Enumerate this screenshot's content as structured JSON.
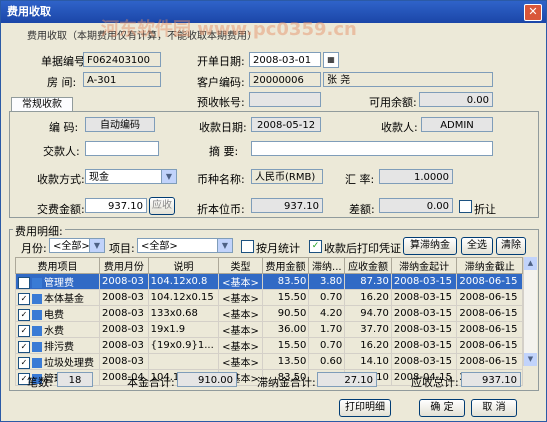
{
  "window": {
    "title": "费用收取",
    "close": "✕"
  },
  "notice": "费用收取（本期费用仅有计算，不能收取本期费用）",
  "watermark": "河东软件园 www.pc0359.cn",
  "header": {
    "bill_no_label": "单据编号:",
    "bill_no_value": "F062403100",
    "open_date_label": "开单日期:",
    "open_date_value": "2008-03-01",
    "room_label": "房 间:",
    "room_value": "A-301",
    "client_code_label": "客户编码:",
    "client_code_value": "20000006",
    "client_name": "张 尧",
    "prepay_label": "预收帐号:",
    "prepay_value": "",
    "balance_label": "可用余额:",
    "balance_value": "0.00"
  },
  "tab_label": "常规收款",
  "form": {
    "code_label": "编 码:",
    "code_value": "自动编码",
    "recv_date_label": "收款日期:",
    "recv_date_value": "2008-05-12",
    "receiver_label": "收款人:",
    "receiver_value": "ADMIN",
    "payer_label": "交款人:",
    "payer_value": "",
    "memo_label": "摘 要:",
    "memo_value": "",
    "method_label": "收款方式:",
    "method_value": "现金",
    "currency_label": "币种名称:",
    "currency_value": "人民币(RMB)",
    "rate_label": "汇 率:",
    "rate_value": "1.0000",
    "pay_amount_label": "交费金额:",
    "pay_amount_value": "937.10",
    "recv_button": "应收",
    "local_amount_label": "折本位币:",
    "local_amount_value": "937.10",
    "diff_label": "差额:",
    "diff_value": "0.00",
    "discount_label": "折让"
  },
  "detail": {
    "group_label": "费用明细:",
    "month_label": "月份:",
    "month_value": "<全部>",
    "item_label": "项目:",
    "item_value": "<全部>",
    "by_month_label": "按月统计",
    "print_after_label": "收款后打印凭证",
    "calc_late_button": "算滞纳金",
    "select_all_button": "全选",
    "clear_button": "清除"
  },
  "table": {
    "columns": [
      "费用项目",
      "费用月份",
      "说明",
      "类型",
      "费用金额",
      "滞纳...",
      "应收金额",
      "滞纳金起计",
      "滞纳金截止"
    ],
    "rows": [
      [
        "管理费",
        "2008-03",
        "104.12x0.8",
        "<基本>",
        "83.50",
        "3.80",
        "87.30",
        "2008-03-15",
        "2008-06-15"
      ],
      [
        "本体基金",
        "2008-03",
        "104.12x0.15",
        "<基本>",
        "15.50",
        "0.70",
        "16.20",
        "2008-03-15",
        "2008-06-15"
      ],
      [
        "电费",
        "2008-03",
        "133x0.68",
        "<基本>",
        "90.50",
        "4.20",
        "94.70",
        "2008-03-15",
        "2008-06-15"
      ],
      [
        "水费",
        "2008-03",
        "19x1.9",
        "<基本>",
        "36.00",
        "1.70",
        "37.70",
        "2008-03-15",
        "2008-06-15"
      ],
      [
        "排污费",
        "2008-03",
        "{19x0.9}1...",
        "<基本>",
        "15.50",
        "0.70",
        "16.20",
        "2008-03-15",
        "2008-06-15"
      ],
      [
        "垃圾处理费",
        "2008-03",
        "",
        "<基本>",
        "13.50",
        "0.60",
        "14.10",
        "2008-03-15",
        "2008-06-15"
      ],
      [
        "管理费",
        "2008-04",
        "104.12x0.8",
        "<基本>",
        "83.50",
        "2.60",
        "86.10",
        "2008-04-15",
        "2008-06-15"
      ]
    ]
  },
  "summary": {
    "count_label": "笔数:",
    "count_value": "18",
    "principal_label": "本金合计:",
    "principal_value": "910.00",
    "late_label": "滞纳金合计:",
    "late_value": "27.10",
    "total_label": "应收总计:",
    "total_value": "937.10"
  },
  "footer": {
    "print_button": "打印明细",
    "ok_button": "确 定",
    "cancel_button": "取 消"
  }
}
